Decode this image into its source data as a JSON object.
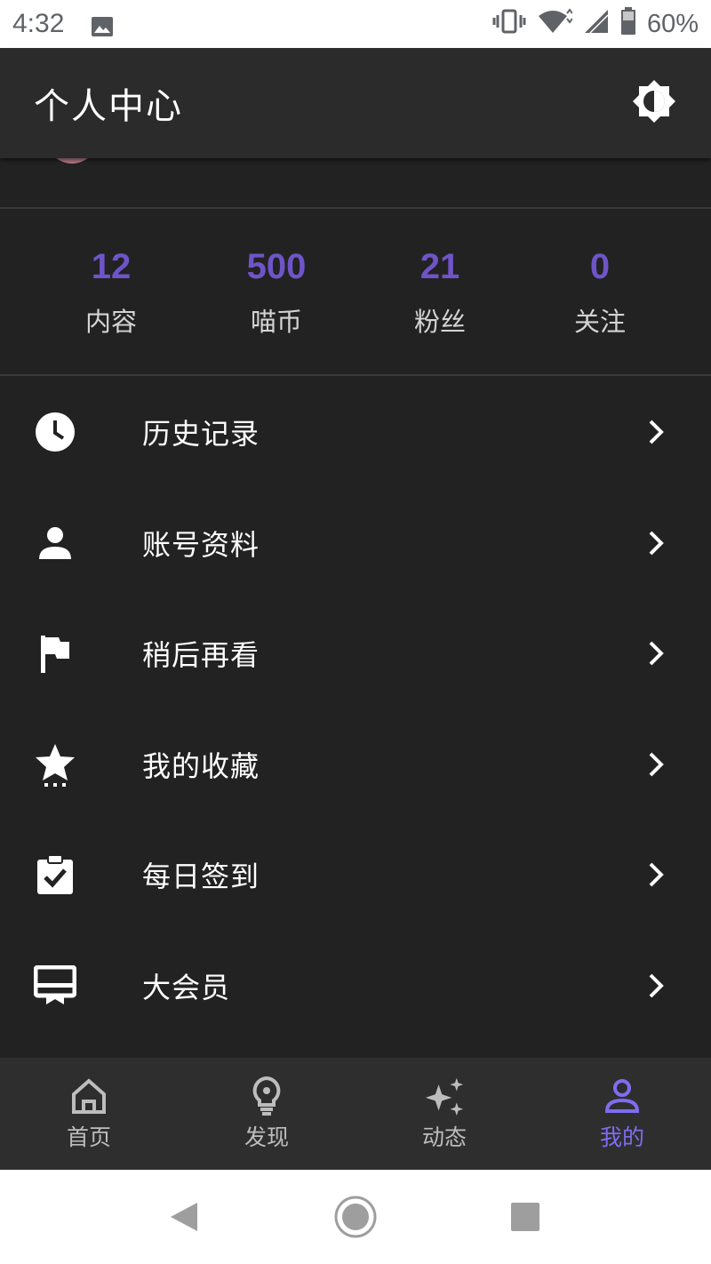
{
  "status_bar": {
    "time": "4:32",
    "battery": "60%",
    "icons": [
      "image-icon",
      "vibrate-icon",
      "wifi-icon",
      "signal-icon",
      "battery-icon"
    ]
  },
  "app_bar": {
    "title": "个人中心",
    "theme_icon": "brightness-icon"
  },
  "stats": [
    {
      "value": "12",
      "label": "内容"
    },
    {
      "value": "500",
      "label": "喵币"
    },
    {
      "value": "21",
      "label": "粉丝"
    },
    {
      "value": "0",
      "label": "关注"
    }
  ],
  "menu": [
    {
      "label": "历史记录",
      "icon": "clock-icon"
    },
    {
      "label": "账号资料",
      "icon": "person-icon"
    },
    {
      "label": "稍后再看",
      "icon": "flag-icon"
    },
    {
      "label": "我的收藏",
      "icon": "star-icon"
    },
    {
      "label": "每日签到",
      "icon": "clipboard-check-icon"
    },
    {
      "label": "大会员",
      "icon": "card-membership-icon"
    }
  ],
  "bottom_nav": [
    {
      "label": "首页",
      "icon": "home-icon",
      "active": false
    },
    {
      "label": "发现",
      "icon": "lightbulb-icon",
      "active": false
    },
    {
      "label": "动态",
      "icon": "sparkle-icon",
      "active": false
    },
    {
      "label": "我的",
      "icon": "person-outline-icon",
      "active": true
    }
  ],
  "colors": {
    "accent": "#6f54c9",
    "active_nav": "#7f6df0",
    "background": "#222223",
    "app_bar": "#2b2b2c"
  }
}
